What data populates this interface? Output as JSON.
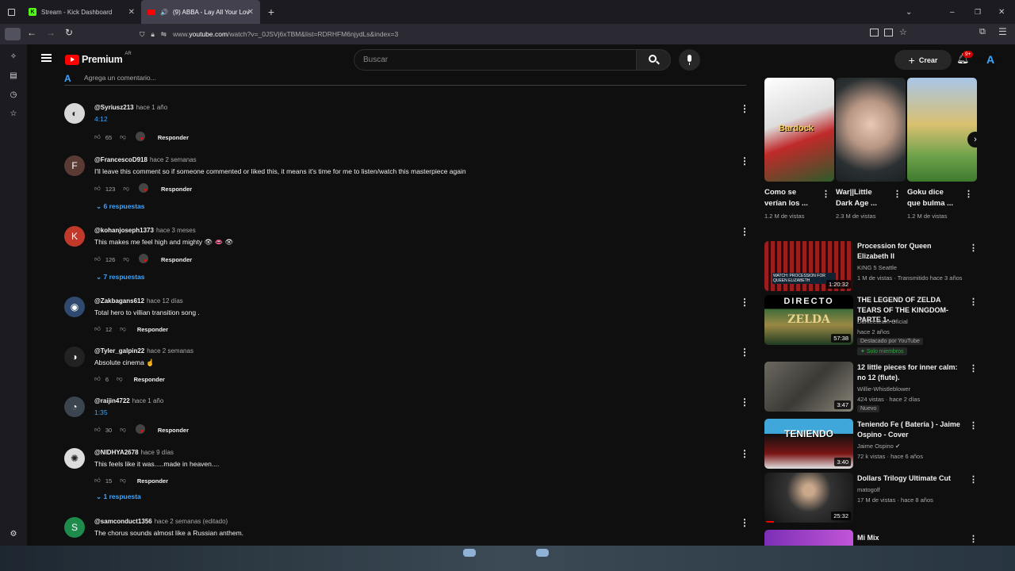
{
  "browser": {
    "tabs": [
      {
        "label": "Stream - Kick Dashboard",
        "active": false
      },
      {
        "label": "(9) ABBA - Lay All Your Lov",
        "active": true
      }
    ],
    "url_prefix": "www.",
    "url_domain": "youtube.com",
    "url_path": "/watch?v=_0JSVj6xTBM&list=RDRHFM6njydLs&index=3"
  },
  "masthead": {
    "logo_text": "Premium",
    "logo_region": "AR",
    "search_placeholder": "Buscar",
    "create_label": "Crear",
    "notif_count": "9+"
  },
  "comments_header": {
    "add_placeholder": "Agrega un comentario..."
  },
  "comments": [
    {
      "user": "@Syriusz213",
      "time": "hace 1 año",
      "text": "4:12",
      "is_link": true,
      "likes": "65",
      "hearted": true,
      "reply_label": "Responder",
      "replies": ""
    },
    {
      "user": "@FrancescoD918",
      "time": "hace 2 semanas",
      "text": "I'll leave this comment so if someone commented or liked this, it means it's time for me to listen/watch this masterpiece again",
      "is_link": false,
      "likes": "123",
      "hearted": true,
      "reply_label": "Responder",
      "replies": "6 respuestas",
      "avatar_letter": "F",
      "avatar_color": "#5a3b33"
    },
    {
      "user": "@kohanjoseph1373",
      "time": "hace 3 meses",
      "text": "This makes me feel high and mighty 👁 👄 👁",
      "is_link": false,
      "likes": "126",
      "hearted": true,
      "reply_label": "Responder",
      "replies": "7 respuestas",
      "avatar_letter": "K",
      "avatar_color": "#c0392b"
    },
    {
      "user": "@Zakbagans612",
      "time": "hace 12 días",
      "text": "Total hero to villian transition song .",
      "is_link": false,
      "likes": "12",
      "hearted": false,
      "reply_label": "Responder",
      "replies": ""
    },
    {
      "user": "@Tyler_galpin22",
      "time": "hace 2 semanas",
      "text": "Absolute cinema ☝",
      "is_link": false,
      "likes": "6",
      "hearted": false,
      "reply_label": "Responder",
      "replies": ""
    },
    {
      "user": "@raijin4722",
      "time": "hace 1 año",
      "text": "1:35",
      "is_link": true,
      "likes": "30",
      "hearted": true,
      "reply_label": "Responder",
      "replies": ""
    },
    {
      "user": "@NIDHYA2678",
      "time": "hace 9 días",
      "text": "This feels like it was.....made in heaven....",
      "is_link": false,
      "likes": "15",
      "hearted": false,
      "reply_label": "Responder",
      "replies": "1 respuesta"
    },
    {
      "user": "@samconduct1356",
      "time": "hace 2 semanas (editado)",
      "text": "The chorus sounds almost like a Russian anthem.",
      "is_link": false,
      "likes": "",
      "hearted": false,
      "reply_label": "",
      "replies": "",
      "avatar_letter": "S",
      "avatar_color": "#1e8a4c"
    }
  ],
  "shorts": [
    {
      "title1": "Como se",
      "title2": "verían los ...",
      "views": "1.2 M de vistas",
      "overlay": "Bardock"
    },
    {
      "title1": "War||Little",
      "title2": "Dark Age ...",
      "views": "2.3 M de vistas",
      "overlay": ""
    },
    {
      "title1": "Goku dice",
      "title2": "que bulma ...",
      "views": "1.2 M de vistas",
      "overlay": ""
    }
  ],
  "videos": [
    {
      "title": "Procession for Queen Elizabeth II",
      "channel": "KING 5 Seattle",
      "meta": "1 M de vistas · Transmitido hace 3 años",
      "duration": "1:20:32",
      "thumb_text": "WATCH: PROCESSION FOR QUEEN ELIZABETH"
    },
    {
      "title": "THE LEGEND OF ZELDA TEARS OF THE KINGDOM-PARTE 1-...",
      "channel": "Danteeteam Oficial",
      "meta": "hace 2 años",
      "badge1": "Destacado por YouTube",
      "badge2": "Solo miembros",
      "duration": "57:38",
      "thumb_text": "DIRECTO",
      "thumb_sub": "ZELDA"
    },
    {
      "title": "12 little pieces for inner calm: no 12 (flute).",
      "channel": "Willie-Whistleblower",
      "meta": "424 vistas · hace 2 días",
      "badge1": "Nuevo",
      "duration": "3:47"
    },
    {
      "title": "Teniendo Fe ( Batería ) - Jaime Ospino - Cover",
      "channel": "Jaime Ospino",
      "meta": "72 k vistas · hace 6 años",
      "duration": "3:40",
      "thumb_text": "TENIENDO"
    },
    {
      "title": "Dollars Trilogy Ultimate Cut",
      "channel": "matogolf",
      "meta": "17 M de vistas · hace 8 años",
      "duration": "25:32"
    },
    {
      "title": "Mi Mix",
      "channel": "",
      "meta": ""
    }
  ]
}
